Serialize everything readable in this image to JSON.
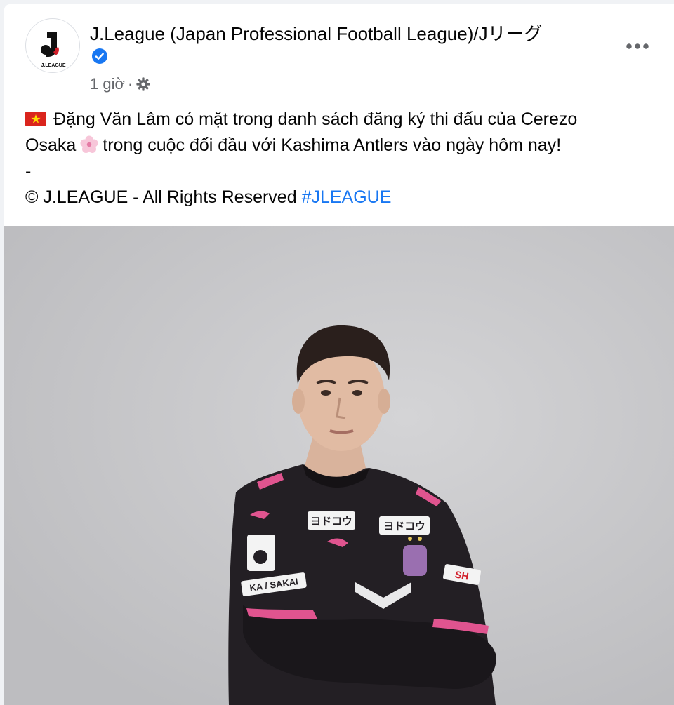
{
  "post": {
    "page_name": "J.League (Japan Professional Football League)/Jリーグ",
    "verified": true,
    "timestamp": "1 giờ",
    "separator": "·",
    "audience_icon": "gear-icon",
    "more_icon": "more-options-icon",
    "text_line1": "Đặng Văn Lâm có mặt trong danh sách đăng ký thi đấu của Cerezo",
    "text_line2a": "Osaka",
    "text_line2b": "trong cuộc đối đầu với Kashima Antlers vào ngày hôm nay!",
    "text_line3": "-",
    "text_line4": "© J.LEAGUE - All Rights Reserved",
    "hashtag": "#JLEAGUE"
  },
  "avatar": {
    "logo_text": "J.LEAGUE"
  },
  "photo": {
    "jersey_sponsor_front": "ヨドコウ",
    "jersey_sponsor_sleeve": "ヨドコウ",
    "jersey_sleeve_text": "KA / SAKAI",
    "jersey_side_text": "SH"
  },
  "colors": {
    "link": "#1877f2",
    "secondary_text": "#65676b",
    "verified": "#1877f2",
    "jersey": "#231f24",
    "jersey_accent": "#e0548f",
    "photo_background": "#c6c6c8"
  }
}
